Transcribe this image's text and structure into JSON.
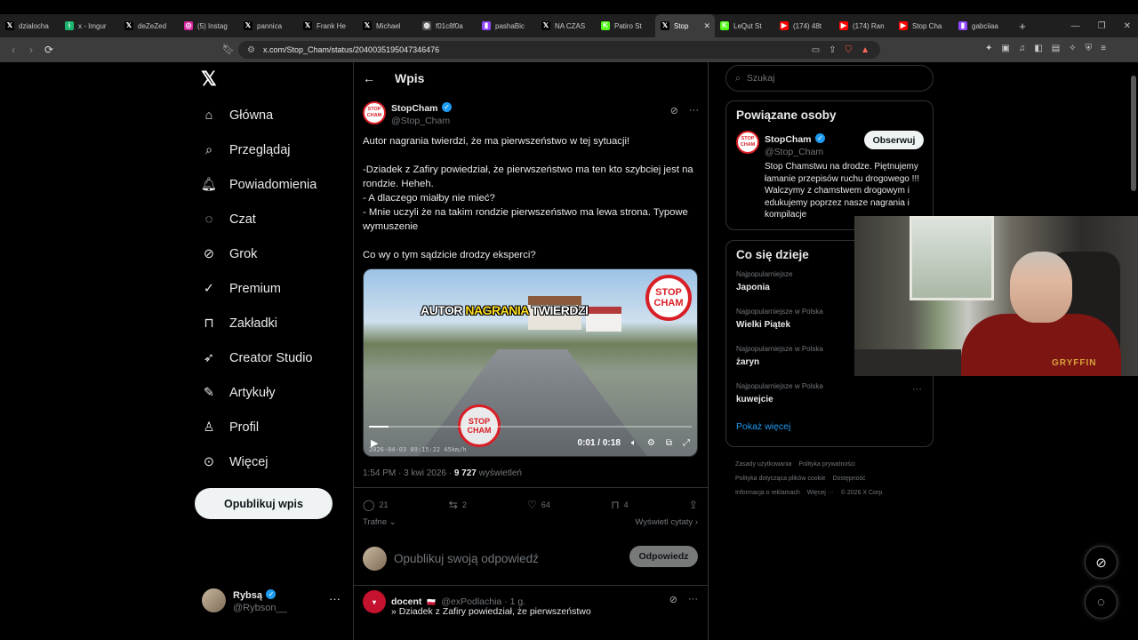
{
  "browser": {
    "tabs": [
      {
        "label": "dzialocha",
        "icon": "x-icon",
        "color": "#000000"
      },
      {
        "label": "x - Imgur",
        "icon": "imgur-icon",
        "color": "#1bb76e"
      },
      {
        "label": "deZeZed",
        "icon": "x-icon",
        "color": "#000000"
      },
      {
        "label": "(5) Instag",
        "icon": "instagram-icon",
        "color": "#d6249f"
      },
      {
        "label": "pannica",
        "icon": "x-icon",
        "color": "#000000"
      },
      {
        "label": "Frank He",
        "icon": "x-icon",
        "color": "#000000"
      },
      {
        "label": "Michael",
        "icon": "x-icon",
        "color": "#000000"
      },
      {
        "label": "f01c8f0a",
        "icon": "globe-icon",
        "color": "#555555"
      },
      {
        "label": "pashaBic",
        "icon": "twitch-icon",
        "color": "#9146ff"
      },
      {
        "label": "NA CZAS",
        "icon": "x-icon",
        "color": "#000000"
      },
      {
        "label": "Patiro St",
        "icon": "kick-icon",
        "color": "#53fc18"
      },
      {
        "label": "Stop",
        "icon": "x-icon",
        "color": "#000000",
        "active": true
      },
      {
        "label": "LeQut St",
        "icon": "kick-icon",
        "color": "#53fc18"
      },
      {
        "label": "(174) 48t",
        "icon": "youtube-icon",
        "color": "#ff0000"
      },
      {
        "label": "(174) Ran",
        "icon": "youtube-icon",
        "color": "#ff0000"
      },
      {
        "label": "Stop Cha",
        "icon": "youtube-icon",
        "color": "#ff0000"
      },
      {
        "label": "gabciiaa",
        "icon": "twitch-icon",
        "color": "#9146ff"
      }
    ],
    "url": "x.com/Stop_Cham/status/2040035195047346476"
  },
  "nav": {
    "items": [
      {
        "label": "Główna",
        "icon": "home-icon"
      },
      {
        "label": "Przeglądaj",
        "icon": "search-icon"
      },
      {
        "label": "Powiadomienia",
        "icon": "bell-icon"
      },
      {
        "label": "Czat",
        "icon": "chat-icon"
      },
      {
        "label": "Grok",
        "icon": "grok-icon"
      },
      {
        "label": "Premium",
        "icon": "premium-icon"
      },
      {
        "label": "Zakładki",
        "icon": "bookmark-icon"
      },
      {
        "label": "Creator Studio",
        "icon": "rocket-icon"
      },
      {
        "label": "Artykuły",
        "icon": "article-icon"
      },
      {
        "label": "Profil",
        "icon": "person-icon"
      },
      {
        "label": "Więcej",
        "icon": "more-icon"
      }
    ],
    "post_button": "Opublikuj wpis"
  },
  "account": {
    "name": "Rybsą",
    "handle": "@Rybson__"
  },
  "page": {
    "title": "Wpis"
  },
  "tweet": {
    "author_name": "StopCham",
    "author_handle": "@Stop_Cham",
    "avatar_text": "STOP CHAM",
    "text": "Autor nagrania twierdzi, że ma pierwszeństwo w tej sytuacji!\n\n-Dziadek z Zafiry powiedział, że pierwszeństwo ma ten kto szybciej jest na rondzie. Heheh.\n- A dlaczego miałby nie mieć?\n- Mnie uczyli że na takim rondzie pierwszeństwo ma lewa strona. Typowe wymuszenie\n\nCo wy o tym sądzicie drodzy eksperci?",
    "video": {
      "caption_a": "AUTOR ",
      "caption_b": "NAGRANIA",
      "caption_c": " TWIERDZI",
      "badge": "STOP CHAM",
      "time": "0:01 / 0:18",
      "progress": 0.06,
      "stamp": "2026-04-03 09:15:22     45km/h"
    },
    "time": "1:54 PM · 3 kwi 2026 · ",
    "views_count": "9 727",
    "views_label": " wyświetleń",
    "replies": "21",
    "reposts": "2",
    "likes": "64",
    "bookmarks": "4",
    "sort_label": "Trafne",
    "quotes_label": "Wyświetl cytaty"
  },
  "reply_box": {
    "placeholder": "Opublikuj swoją odpowiedź",
    "button": "Odpowiedz"
  },
  "reply": {
    "name": "docent",
    "handle": "@exPodlachia · 1 g.",
    "text": "» Dziadek z Zafiry powiedział, że pierwszeństwo"
  },
  "sidebar": {
    "search_placeholder": "Szukaj",
    "related_title": "Powiązane osoby",
    "person": {
      "name": "StopCham",
      "handle": "@Stop_Cham",
      "follow": "Obserwuj",
      "bio": "Stop Chamstwu na drodze. Piętnujemy łamanie przepisów ruchu drogowego !!! Walczymy z chamstwem drogowym i edukujemy poprzez nasze nagrania i kompilacje"
    },
    "trends_title": "Co się dzieje",
    "trends": [
      {
        "category": "Najpopularniejsze",
        "name": "Japonia"
      },
      {
        "category": "Najpopularniejsze w Polska",
        "name": "Wielki Piątek"
      },
      {
        "category": "Najpopularniejsze w Polska",
        "name": "żaryn"
      },
      {
        "category": "Najpopularniejsze w Polska",
        "name": "kuwejcie"
      }
    ],
    "show_more": "Pokaż więcej",
    "footer": [
      "Zasady użytkowania",
      "Polityka prywatności",
      "Polityka dotycząca plików cookie",
      "Dostępność",
      "Informacja o reklamach",
      "Więcej ···",
      "© 2026 X Corp."
    ]
  },
  "webcam": {
    "shirt_text": "GRYFFIN"
  },
  "colors": {
    "accent": "#1d9bf0",
    "brand_red": "#d81f26"
  }
}
